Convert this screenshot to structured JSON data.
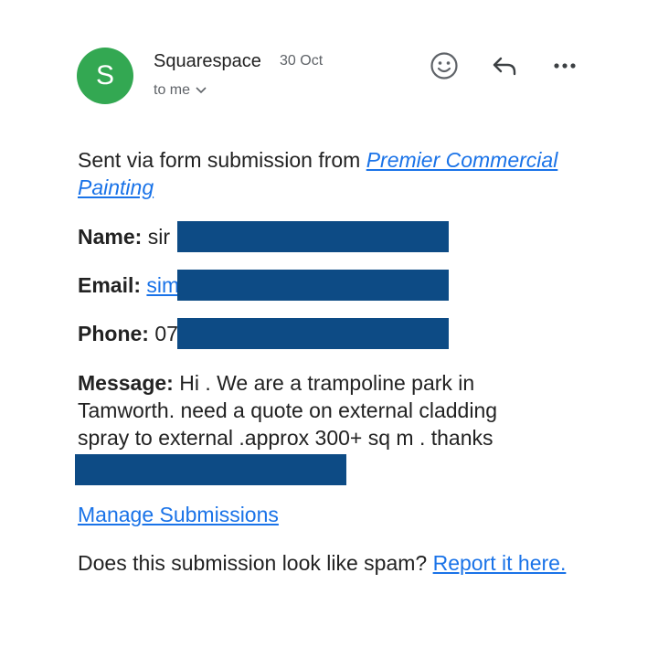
{
  "header": {
    "avatar_letter": "S",
    "sender": "Squarespace",
    "date": "30 Oct",
    "recipient": "to me"
  },
  "icons": {
    "emoji": "smiley-icon",
    "reply": "reply-icon",
    "more": "more-horizontal-icon",
    "chevron": "chevron-down-icon"
  },
  "colors": {
    "avatar": "#33a852",
    "link": "#1a73e8",
    "redaction": "#0d4b85"
  },
  "body": {
    "intro_text": "Sent via form submission from ",
    "site_link": "Premier Commercial Painting",
    "name_label": "Name:",
    "name_value": "sir",
    "email_label": "Email:",
    "email_value": "sim",
    "phone_label": "Phone:",
    "phone_value": "07",
    "message_label": "Message:",
    "message_text": " Hi . We are a trampoline park in Tamworth. need a quote on external cladding spray to external .approx 300+ sq m . thanks",
    "manage_link": "Manage Submissions",
    "spam_text": "Does this submission look like spam? ",
    "report_link": "Report it here."
  }
}
